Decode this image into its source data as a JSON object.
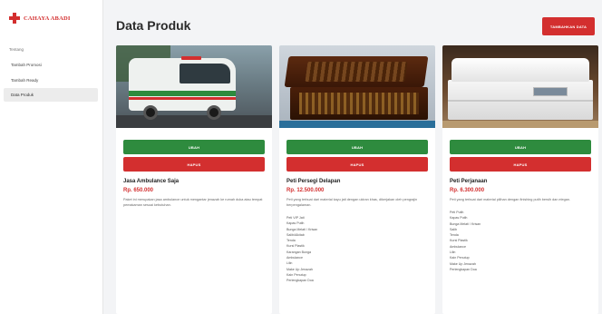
{
  "sidebar": {
    "brand": "CAHAYA ABADI",
    "nav_label": "Tentang",
    "items": [
      {
        "label": "Tambah Promosi",
        "active": false
      },
      {
        "label": "Tambah Ready",
        "active": false
      },
      {
        "label": "Data Produk",
        "active": true
      }
    ]
  },
  "header": {
    "title": "Data Produk",
    "add_button": "TAMBAHKAN DATA"
  },
  "products": [
    {
      "name": "Jasa Ambulance Saja",
      "price": "Rp. 650.000",
      "description": "Paket ini merupakan jasa ambulance untuk mengantar jenazah ke rumah duka atau tempat pemakaman sesuai kebutuhan.",
      "features": []
    },
    {
      "name": "Peti Persegi Delapan",
      "price": "Rp. 12.500.000",
      "description": "Peti yang terbuat dari material kayu jati dengan ukiran khas, dikerjakan oleh pengrajin berpengalaman.",
      "features": [
        "Peti VIP Jati",
        "Kapas Putih",
        "Bunga Melati / Krisan",
        "Salib/Alkitab",
        "Tenda",
        "Kursi Plastik",
        "Karangan Bunga",
        "Ambulance",
        "Lilin",
        "Make Up Jenazah",
        "Kain Penutup",
        "Perlengkapan Doa"
      ]
    },
    {
      "name": "Peti Perjanaan",
      "price": "Rp. 6.300.000",
      "description": "Peti yang terbuat dari material pilihan dengan finishing putih bersih dan elegan.",
      "features": [
        "Peti Putih",
        "Kapas Putih",
        "Bunga Melati / Krisan",
        "Salib",
        "Tenda",
        "Kursi Plastik",
        "Ambulance",
        "Lilin",
        "Kain Penutup",
        "Make Up Jenazah",
        "Perlengkapan Doa"
      ]
    }
  ],
  "labels": {
    "edit": "UBAH",
    "delete": "HAPUS"
  }
}
